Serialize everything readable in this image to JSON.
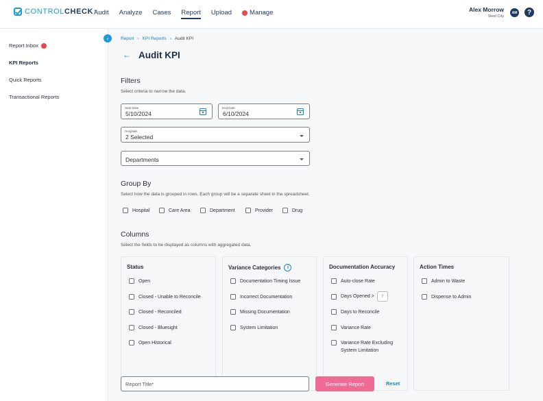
{
  "header": {
    "logo_prefix": "CONTROL",
    "logo_suffix": "CHECK",
    "logo_tm": "™",
    "nav": [
      {
        "label": "Audit"
      },
      {
        "label": "Analyze"
      },
      {
        "label": "Cases"
      },
      {
        "label": "Report",
        "active": true
      },
      {
        "label": "Upload"
      },
      {
        "label": "Manage",
        "alert": true
      }
    ],
    "user_name": "Alex Morrow",
    "user_sub": "Steel City",
    "avatar_initials": "AM",
    "help_label": "?"
  },
  "sidebar": {
    "collapse_icon": "‹",
    "items": [
      {
        "label": "Report Inbox",
        "badge": true
      },
      {
        "label": "KPI Reports",
        "active": true
      },
      {
        "label": "Quick Reports"
      },
      {
        "label": "Transactional Reports"
      }
    ]
  },
  "breadcrumb": {
    "items": [
      "Report",
      "KPI Reports",
      "Audit KPI"
    ],
    "sep": "›"
  },
  "page": {
    "back_icon": "←",
    "title": "Audit KPI"
  },
  "filters": {
    "title": "Filters",
    "subtitle": "Select criteria to narrow the data.",
    "start_date_label": "Start Date",
    "start_date": "5/10/2024",
    "end_date_label": "End Date",
    "end_date": "6/10/2024",
    "hospitals_label": "Hospitals",
    "hospitals_value": "2 Selected",
    "departments_placeholder": "Departments"
  },
  "group_by": {
    "title": "Group By",
    "subtitle": "Select how the data is grouped in rows. Each group will be a separate sheet in the spreadsheet.",
    "options": [
      "Hospital",
      "Care Area",
      "Department",
      "Provider",
      "Drug"
    ]
  },
  "columns": {
    "title": "Columns",
    "subtitle": "Select the fields to be displayed as columns with aggregated data.",
    "cards": [
      {
        "title": "Status",
        "options": [
          "Open",
          "Closed - Unable to Reconcile",
          "Closed - Reconciled",
          "Closed - Bluesight",
          "Open Historical"
        ]
      },
      {
        "title": "Variance Categories",
        "info_icon": "i",
        "options": [
          "Documentation Timing Issue",
          "Incorrect Documentation",
          "Missing Documentation",
          "System Limitation"
        ]
      },
      {
        "title": "Documentation Accuracy",
        "options": [
          "Auto-close Rate",
          "Days Opened >",
          "Days to Reconcile",
          "Variance Rate",
          "Variance Rate Excluding",
          "System Limitation"
        ],
        "days_box": "?"
      },
      {
        "title": "Action Times",
        "options": [
          "Admin to Waste",
          "Dispense to Admin"
        ]
      }
    ]
  },
  "footer": {
    "report_title_placeholder": "Report Title*",
    "generate_label": "Generate Report",
    "reset_label": "Reset"
  },
  "colors": {
    "accent": "#1d9bd7",
    "primary_dark": "#1f3a5f",
    "generate_button": "#ee6b94",
    "alert": "#e5484d"
  }
}
